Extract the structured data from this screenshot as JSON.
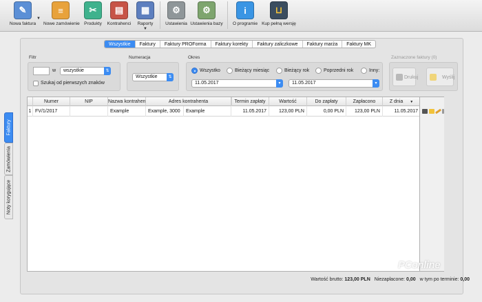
{
  "toolbar": {
    "items": [
      {
        "label": "Nowa faktura",
        "icon": "new-invoice-icon",
        "color": "#5b8fd6"
      },
      {
        "label": "Nowe zamówienie",
        "icon": "new-order-icon",
        "color": "#e8a23b"
      },
      {
        "label": "Produkty",
        "icon": "products-icon",
        "color": "#3fb28d"
      },
      {
        "label": "Kontrahenci",
        "icon": "contractors-icon",
        "color": "#c75447"
      },
      {
        "label": "Raporty",
        "icon": "reports-icon",
        "color": "#5d7fbf"
      },
      {
        "label": "Ustawienia",
        "icon": "settings-gear-icon",
        "color": "#8f9699"
      },
      {
        "label": "Ustawienia bazy",
        "icon": "database-settings-icon",
        "color": "#7ea56e"
      },
      {
        "label": "O programie",
        "icon": "info-icon",
        "color": "#3a95e4"
      },
      {
        "label": "Kup pełną wersję",
        "icon": "shopping-basket-icon",
        "color": "#3b4d5f"
      }
    ]
  },
  "side_tabs": [
    "Faktury",
    "Zamówienia",
    "Noty korygujące"
  ],
  "tabs": [
    "Wszystkie",
    "Faktury",
    "Faktury PROForma",
    "Faktury korekty",
    "Faktury zaliczkowe",
    "Faktury marża",
    "Faktury MK"
  ],
  "filter": {
    "title": "Filtr",
    "in_label": "w",
    "input_value": "",
    "select_value": "wszystkie",
    "checkbox_label": "Szukaj od pierwszych znaków"
  },
  "numeracja": {
    "title": "Numeracja",
    "select_value": "Wszystkie"
  },
  "okres": {
    "title": "Okres",
    "options": [
      "Wszystko",
      "Bieżący miesiąc",
      "Bieżący rok",
      "Poprzedni rok",
      "Inny:"
    ],
    "selected_index": 0,
    "date_from": "11.05.2017",
    "date_to": "11.05.2017"
  },
  "selected_invoices": {
    "title": "Zaznaczone faktury (0)",
    "print_label": "Drukuj",
    "send_label": "Wyślij"
  },
  "table": {
    "columns": [
      "",
      "Numer",
      "NIP",
      "Nazwa kontrahenta",
      "Adres kontrahenta",
      "",
      "Termin zapłaty",
      "Wartość",
      "Do zapłaty",
      "Zapłacono",
      "Z dnia"
    ],
    "rows": [
      {
        "lp": "1",
        "numer": "FV/1/2017",
        "nip": "",
        "nazwa": "Example",
        "adres": "Example, 3000",
        "adres2": "Example",
        "termin": "11.05.2017",
        "wartosc": "123,00 PLN",
        "do_zaplaty": "0,00 PLN",
        "zaplacono": "123,00 PLN",
        "z_dnia": "11.05.2017"
      }
    ]
  },
  "footer": {
    "brutto_label": "Wartość brutto:",
    "brutto_value": "123,00 PLN",
    "niezaplacone_label": "Niezapłacone:",
    "niezaplacone_value": "0,00",
    "po_terminie_label": "w tym po terminie:",
    "po_terminie_value": "0,00"
  },
  "watermark": "PConline"
}
